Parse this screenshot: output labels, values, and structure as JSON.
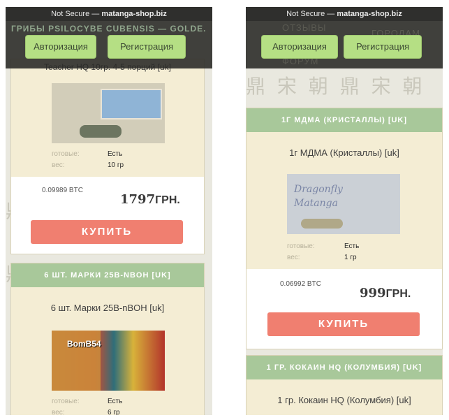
{
  "browser": {
    "url_prefix": "Not Secure — ",
    "url_domain": "matanga-shop.biz"
  },
  "nav": {
    "login_label": "Авторизация",
    "register_label": "Регистрация"
  },
  "left": {
    "behind_header_text": "ГРИБЫ PSILOCYBE CUBENSIS — GOLDE...",
    "partial_title": "Teacher HQ 10гр. 4-5 порций [uk]",
    "card1": {
      "stock_key": "готовые:",
      "stock_val": "Есть",
      "weight_key": "вес:",
      "weight_val": "10 гр",
      "btc": "0.09989 BTC",
      "price_num": "1797",
      "price_cur": "ГРН.",
      "buy": "КУПИТЬ"
    },
    "card2": {
      "head": "6 ШТ. МАРКИ 25B-NBOH [UK]",
      "title": "6 шт. Марки 25B-nBOH [uk]",
      "photo_text": "BomB54",
      "stock_key": "готовые:",
      "stock_val": "Есть",
      "weight_key": "вес:",
      "weight_val": "6 гр"
    }
  },
  "right": {
    "behind_header_text": [
      "ОТЗЫВЫ",
      "ГОРОДАМ",
      "ФОРУМ"
    ],
    "card1": {
      "head": "1Г МДМА (КРИСТАЛЛЫ) [UK]",
      "title": "1г МДМА (Кристаллы) [uk]",
      "photo_line1": "Dragonfly",
      "photo_line2": "Matanga",
      "stock_key": "готовые:",
      "stock_val": "Есть",
      "weight_key": "вес:",
      "weight_val": "1 гр",
      "btc": "0.06992 BTC",
      "price_num": "999",
      "price_cur": "ГРН.",
      "buy": "КУПИТЬ"
    },
    "card2": {
      "head": "1 ГР. КОКАИН HQ (КОЛУМБИЯ) [UK]",
      "title": "1 гр. Кокаин HQ (Колумбия) [uk]"
    }
  },
  "colors": {
    "header_green": "#a8c89a",
    "buy_red": "#f07f70",
    "nav_btn": "#b5df84",
    "card_bg": "#f4edd4"
  }
}
